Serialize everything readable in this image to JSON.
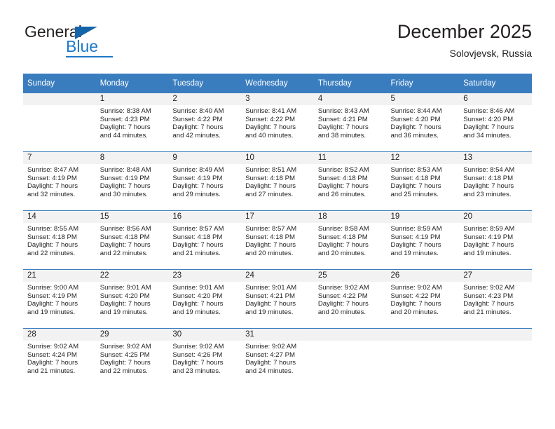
{
  "brand": {
    "name_part1": "General",
    "name_part2": "Blue",
    "logo_icon": "triangle-icon"
  },
  "header": {
    "title": "December 2025",
    "subtitle": "Solovjevsk, Russia"
  },
  "colors": {
    "header_blue": "#3a7dbf",
    "brand_blue": "#1e78c8",
    "daynum_band": "#f2f2f2",
    "text": "#231f20"
  },
  "calendar": {
    "weekday_headers": [
      "Sunday",
      "Monday",
      "Tuesday",
      "Wednesday",
      "Thursday",
      "Friday",
      "Saturday"
    ],
    "weeks": [
      [
        {
          "day": "",
          "sunrise": "",
          "sunset": "",
          "daylight_1": "",
          "daylight_2": "",
          "empty": true
        },
        {
          "day": "1",
          "sunrise": "Sunrise: 8:38 AM",
          "sunset": "Sunset: 4:23 PM",
          "daylight_1": "Daylight: 7 hours",
          "daylight_2": "and 44 minutes."
        },
        {
          "day": "2",
          "sunrise": "Sunrise: 8:40 AM",
          "sunset": "Sunset: 4:22 PM",
          "daylight_1": "Daylight: 7 hours",
          "daylight_2": "and 42 minutes."
        },
        {
          "day": "3",
          "sunrise": "Sunrise: 8:41 AM",
          "sunset": "Sunset: 4:22 PM",
          "daylight_1": "Daylight: 7 hours",
          "daylight_2": "and 40 minutes."
        },
        {
          "day": "4",
          "sunrise": "Sunrise: 8:43 AM",
          "sunset": "Sunset: 4:21 PM",
          "daylight_1": "Daylight: 7 hours",
          "daylight_2": "and 38 minutes."
        },
        {
          "day": "5",
          "sunrise": "Sunrise: 8:44 AM",
          "sunset": "Sunset: 4:20 PM",
          "daylight_1": "Daylight: 7 hours",
          "daylight_2": "and 36 minutes."
        },
        {
          "day": "6",
          "sunrise": "Sunrise: 8:46 AM",
          "sunset": "Sunset: 4:20 PM",
          "daylight_1": "Daylight: 7 hours",
          "daylight_2": "and 34 minutes."
        }
      ],
      [
        {
          "day": "7",
          "sunrise": "Sunrise: 8:47 AM",
          "sunset": "Sunset: 4:19 PM",
          "daylight_1": "Daylight: 7 hours",
          "daylight_2": "and 32 minutes."
        },
        {
          "day": "8",
          "sunrise": "Sunrise: 8:48 AM",
          "sunset": "Sunset: 4:19 PM",
          "daylight_1": "Daylight: 7 hours",
          "daylight_2": "and 30 minutes."
        },
        {
          "day": "9",
          "sunrise": "Sunrise: 8:49 AM",
          "sunset": "Sunset: 4:19 PM",
          "daylight_1": "Daylight: 7 hours",
          "daylight_2": "and 29 minutes."
        },
        {
          "day": "10",
          "sunrise": "Sunrise: 8:51 AM",
          "sunset": "Sunset: 4:18 PM",
          "daylight_1": "Daylight: 7 hours",
          "daylight_2": "and 27 minutes."
        },
        {
          "day": "11",
          "sunrise": "Sunrise: 8:52 AM",
          "sunset": "Sunset: 4:18 PM",
          "daylight_1": "Daylight: 7 hours",
          "daylight_2": "and 26 minutes."
        },
        {
          "day": "12",
          "sunrise": "Sunrise: 8:53 AM",
          "sunset": "Sunset: 4:18 PM",
          "daylight_1": "Daylight: 7 hours",
          "daylight_2": "and 25 minutes."
        },
        {
          "day": "13",
          "sunrise": "Sunrise: 8:54 AM",
          "sunset": "Sunset: 4:18 PM",
          "daylight_1": "Daylight: 7 hours",
          "daylight_2": "and 23 minutes."
        }
      ],
      [
        {
          "day": "14",
          "sunrise": "Sunrise: 8:55 AM",
          "sunset": "Sunset: 4:18 PM",
          "daylight_1": "Daylight: 7 hours",
          "daylight_2": "and 22 minutes."
        },
        {
          "day": "15",
          "sunrise": "Sunrise: 8:56 AM",
          "sunset": "Sunset: 4:18 PM",
          "daylight_1": "Daylight: 7 hours",
          "daylight_2": "and 22 minutes."
        },
        {
          "day": "16",
          "sunrise": "Sunrise: 8:57 AM",
          "sunset": "Sunset: 4:18 PM",
          "daylight_1": "Daylight: 7 hours",
          "daylight_2": "and 21 minutes."
        },
        {
          "day": "17",
          "sunrise": "Sunrise: 8:57 AM",
          "sunset": "Sunset: 4:18 PM",
          "daylight_1": "Daylight: 7 hours",
          "daylight_2": "and 20 minutes."
        },
        {
          "day": "18",
          "sunrise": "Sunrise: 8:58 AM",
          "sunset": "Sunset: 4:18 PM",
          "daylight_1": "Daylight: 7 hours",
          "daylight_2": "and 20 minutes."
        },
        {
          "day": "19",
          "sunrise": "Sunrise: 8:59 AM",
          "sunset": "Sunset: 4:19 PM",
          "daylight_1": "Daylight: 7 hours",
          "daylight_2": "and 19 minutes."
        },
        {
          "day": "20",
          "sunrise": "Sunrise: 8:59 AM",
          "sunset": "Sunset: 4:19 PM",
          "daylight_1": "Daylight: 7 hours",
          "daylight_2": "and 19 minutes."
        }
      ],
      [
        {
          "day": "21",
          "sunrise": "Sunrise: 9:00 AM",
          "sunset": "Sunset: 4:19 PM",
          "daylight_1": "Daylight: 7 hours",
          "daylight_2": "and 19 minutes."
        },
        {
          "day": "22",
          "sunrise": "Sunrise: 9:01 AM",
          "sunset": "Sunset: 4:20 PM",
          "daylight_1": "Daylight: 7 hours",
          "daylight_2": "and 19 minutes."
        },
        {
          "day": "23",
          "sunrise": "Sunrise: 9:01 AM",
          "sunset": "Sunset: 4:20 PM",
          "daylight_1": "Daylight: 7 hours",
          "daylight_2": "and 19 minutes."
        },
        {
          "day": "24",
          "sunrise": "Sunrise: 9:01 AM",
          "sunset": "Sunset: 4:21 PM",
          "daylight_1": "Daylight: 7 hours",
          "daylight_2": "and 19 minutes."
        },
        {
          "day": "25",
          "sunrise": "Sunrise: 9:02 AM",
          "sunset": "Sunset: 4:22 PM",
          "daylight_1": "Daylight: 7 hours",
          "daylight_2": "and 20 minutes."
        },
        {
          "day": "26",
          "sunrise": "Sunrise: 9:02 AM",
          "sunset": "Sunset: 4:22 PM",
          "daylight_1": "Daylight: 7 hours",
          "daylight_2": "and 20 minutes."
        },
        {
          "day": "27",
          "sunrise": "Sunrise: 9:02 AM",
          "sunset": "Sunset: 4:23 PM",
          "daylight_1": "Daylight: 7 hours",
          "daylight_2": "and 21 minutes."
        }
      ],
      [
        {
          "day": "28",
          "sunrise": "Sunrise: 9:02 AM",
          "sunset": "Sunset: 4:24 PM",
          "daylight_1": "Daylight: 7 hours",
          "daylight_2": "and 21 minutes."
        },
        {
          "day": "29",
          "sunrise": "Sunrise: 9:02 AM",
          "sunset": "Sunset: 4:25 PM",
          "daylight_1": "Daylight: 7 hours",
          "daylight_2": "and 22 minutes."
        },
        {
          "day": "30",
          "sunrise": "Sunrise: 9:02 AM",
          "sunset": "Sunset: 4:26 PM",
          "daylight_1": "Daylight: 7 hours",
          "daylight_2": "and 23 minutes."
        },
        {
          "day": "31",
          "sunrise": "Sunrise: 9:02 AM",
          "sunset": "Sunset: 4:27 PM",
          "daylight_1": "Daylight: 7 hours",
          "daylight_2": "and 24 minutes."
        },
        {
          "day": "",
          "sunrise": "",
          "sunset": "",
          "daylight_1": "",
          "daylight_2": "",
          "empty": true
        },
        {
          "day": "",
          "sunrise": "",
          "sunset": "",
          "daylight_1": "",
          "daylight_2": "",
          "empty": true
        },
        {
          "day": "",
          "sunrise": "",
          "sunset": "",
          "daylight_1": "",
          "daylight_2": "",
          "empty": true
        }
      ]
    ]
  }
}
